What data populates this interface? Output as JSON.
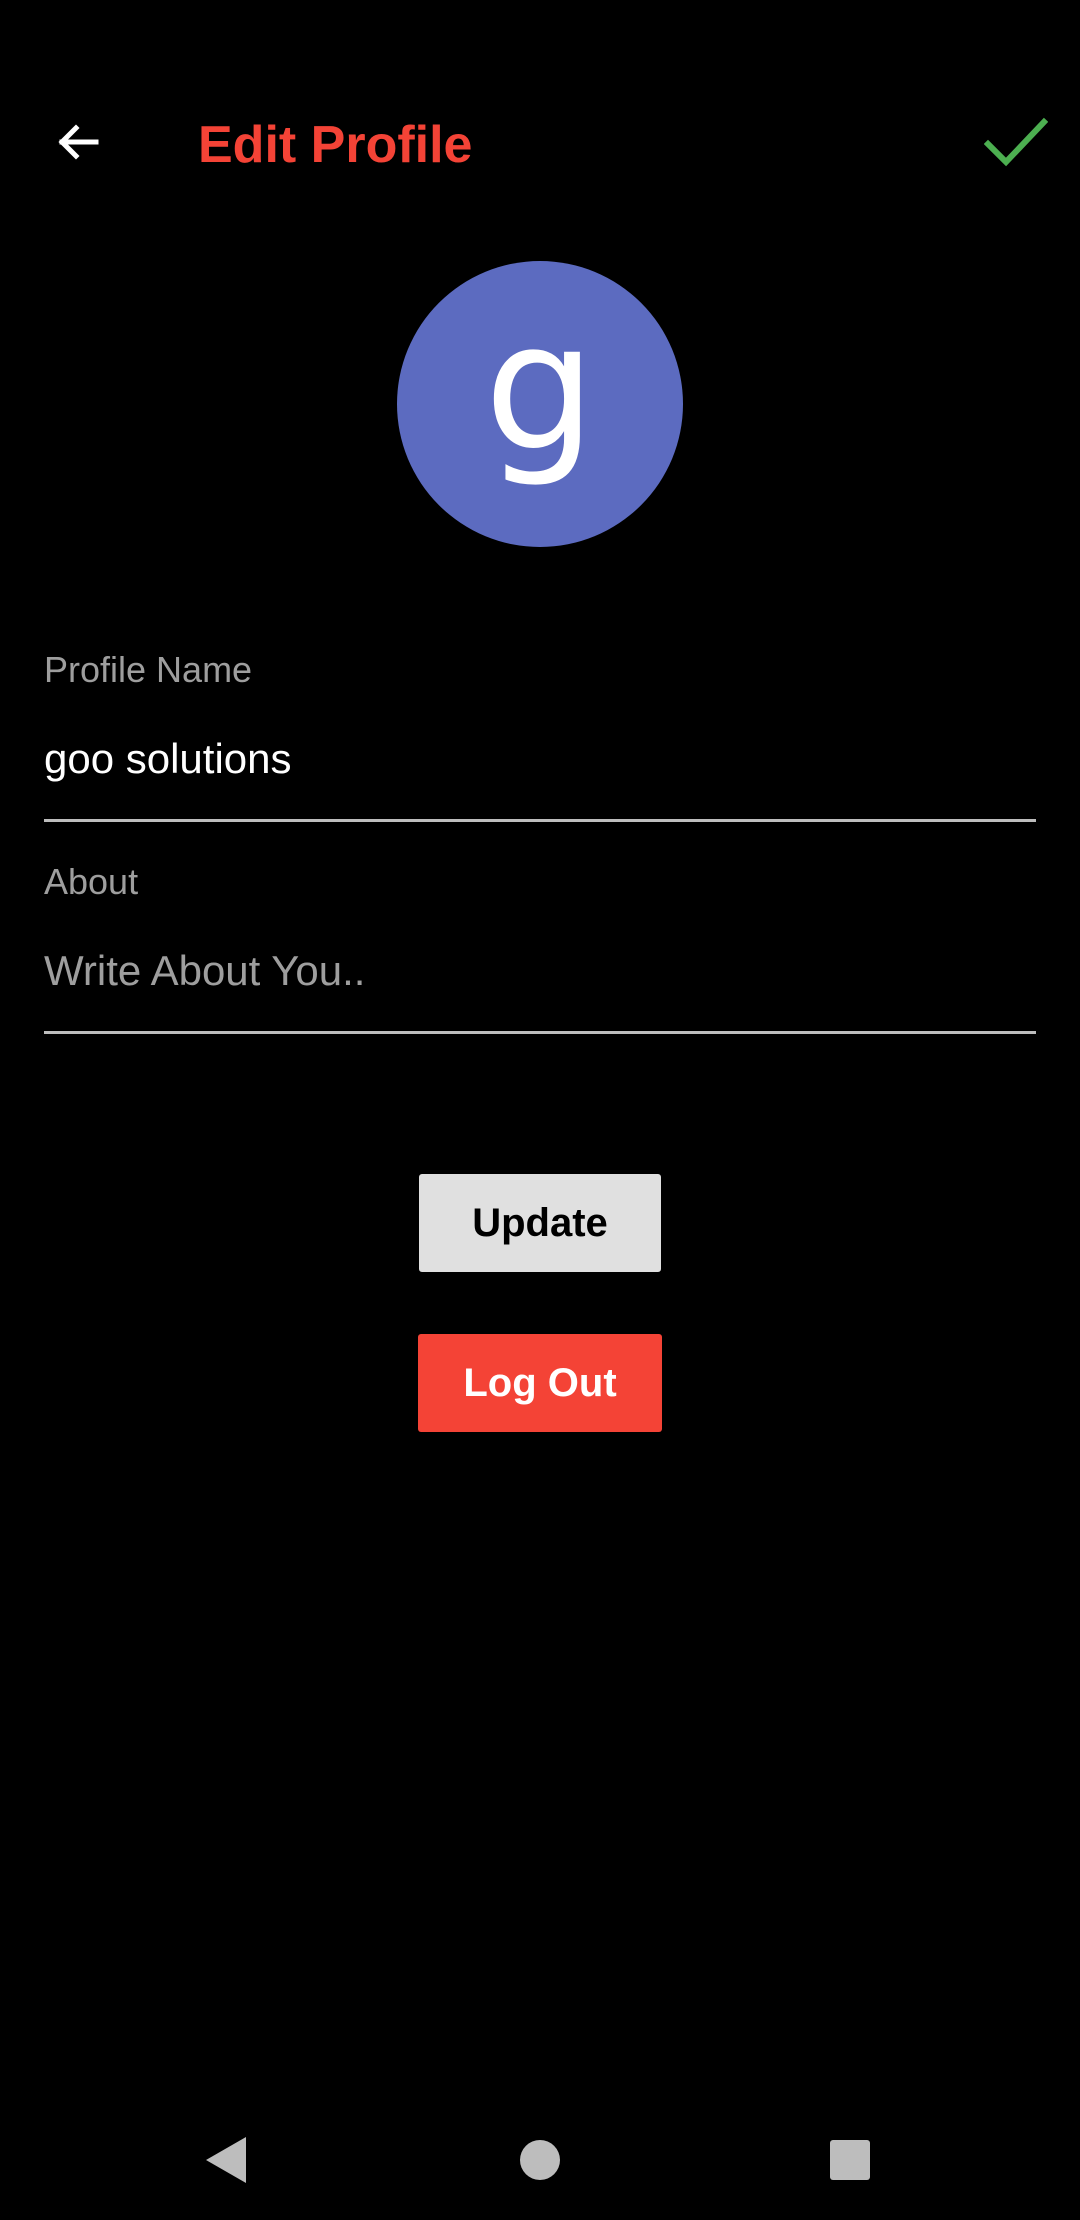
{
  "app": {
    "title": "Edit Profile",
    "accent_color": "#F44336",
    "confirm_color": "#4CAF50"
  },
  "header": {
    "back_icon": "arrow-back-icon",
    "confirm_icon": "check-icon"
  },
  "avatar": {
    "letter": "g",
    "background": "#5C6BC0"
  },
  "form": {
    "profile_name": {
      "label": "Profile Name",
      "value": "goo solutions"
    },
    "about": {
      "label": "About",
      "value": "",
      "placeholder": "Write About You.."
    }
  },
  "actions": {
    "update_label": "Update",
    "logout_label": "Log Out"
  },
  "system_nav": {
    "back_icon": "nav-back-icon",
    "home_icon": "nav-home-icon",
    "recents_icon": "nav-recents-icon"
  }
}
